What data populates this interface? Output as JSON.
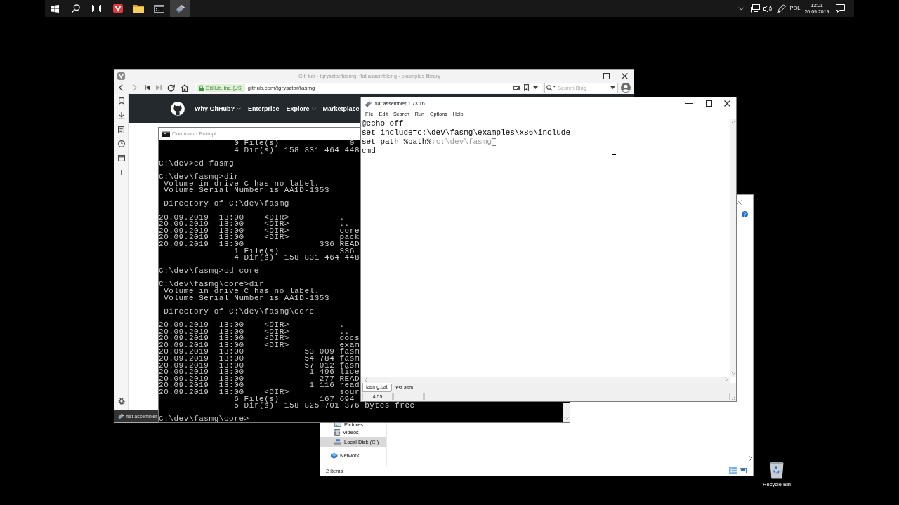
{
  "taskbar": {
    "buttons": [
      {
        "kind": "start",
        "active": false
      },
      {
        "kind": "search",
        "active": false
      },
      {
        "kind": "taskview",
        "active": false
      },
      {
        "kind": "browser",
        "active": false
      },
      {
        "kind": "files",
        "active": false
      },
      {
        "kind": "terminal",
        "active": false
      },
      {
        "kind": "assembler",
        "active": true
      }
    ],
    "tray": {
      "language": "POL",
      "time": "13:01",
      "date": "20.09.2019"
    }
  },
  "browser": {
    "active": false,
    "title": "GitHub - tgrysztar/fasmg: flat assembler g - examples library",
    "site_badge": "GitHub, Inc. [US]",
    "url": "github.com/tgrysztar/fasmg",
    "search": {
      "placeholder": "Search Bing"
    },
    "site_nav": [
      {
        "label": "Why GitHub?",
        "dropdown": true
      },
      {
        "label": "Enterprise",
        "dropdown": false
      },
      {
        "label": "Explore",
        "dropdown": true
      },
      {
        "label": "Marketplace",
        "dropdown": false
      }
    ],
    "bottom_tab": "flat assembler"
  },
  "console": {
    "active": false,
    "title": "Command Prompt",
    "blocks": [
      [
        "               0 File(s)              0",
        "               4 Dir(s)  158 831 464 448"
      ],
      [
        "C:\\dev>cd fasmg"
      ],
      [
        "C:\\dev\\fasmg>dir",
        " Volume in drive C has no label.",
        " Volume Serial Number is AA1D-1353"
      ],
      [
        " Directory of C:\\dev\\fasmg"
      ],
      [
        "20.09.2019  13:00    <DIR>          .",
        "20.09.2019  13:00    <DIR>          ..",
        "20.09.2019  13:00    <DIR>          core",
        "20.09.2019  13:00    <DIR>          pack",
        "20.09.2019  13:00               336 READ",
        "               1 File(s)            336",
        "               4 Dir(s)  158 831 464 448"
      ],
      [
        "C:\\dev\\fasmg>cd core"
      ],
      [
        "C:\\dev\\fasmg\\core>dir",
        " Volume in drive C has no label.",
        " Volume Serial Number is AA1D-1353"
      ],
      [
        " Directory of C:\\dev\\fasmg\\core"
      ],
      [
        "20.09.2019  13:00    <DIR>          .",
        "20.09.2019  13:00    <DIR>          ..",
        "20.09.2019  13:00    <DIR>          docs",
        "20.09.2019  13:00    <DIR>          exam",
        "20.09.2019  13:00            53 009 fasm",
        "20.09.2019  13:00            54 784 fasm",
        "20.09.2019  13:00            57 012 fasm",
        "20.09.2019  13:00             1 496 lice",
        "20.09.2019  13:00               277 READ",
        "20.09.2019  13:00             1 116 read",
        "20.09.2019  13:00    <DIR>          sour",
        "               6 File(s)        167 694",
        "               5 Dir(s)  158 825 701 376 bytes free"
      ],
      [
        "C:\\dev\\fasmg\\core>"
      ]
    ]
  },
  "editor": {
    "active": true,
    "title": "flat assembler 1.73.16",
    "menu": [
      "File",
      "Edit",
      "Search",
      "Run",
      "Options",
      "Help"
    ],
    "lines": [
      {
        "segments": [
          {
            "text": "@echo off",
            "faded": false
          }
        ]
      },
      {
        "segments": [
          {
            "text": "set include=c:\\dev\\fasmg\\examples\\x86\\include",
            "faded": false
          }
        ]
      },
      {
        "segments": [
          {
            "text": "set path=%path%",
            "faded": false
          },
          {
            "text": ";c:\\dev\\fasmg",
            "faded": true
          }
        ]
      },
      {
        "segments": [
          {
            "text": "cmd",
            "faded": false
          }
        ]
      }
    ],
    "tabs": [
      {
        "label": "fasmg.bat",
        "selected": true
      },
      {
        "label": "test.asm",
        "selected": false
      }
    ],
    "status": "4,55"
  },
  "explorer": {
    "navigation": [
      {
        "kind": "pictures",
        "label": "Pictures",
        "selected": false
      },
      {
        "kind": "videos",
        "label": "Videos",
        "selected": false
      },
      {
        "kind": "drive",
        "label": "Local Disk (C:)",
        "selected": true
      },
      {
        "kind": "network",
        "label": "Network",
        "selected": false
      }
    ],
    "status": "2 items",
    "views": [
      {
        "kind": "details",
        "selected": true
      },
      {
        "kind": "tiles",
        "selected": false
      }
    ]
  },
  "desktop_icons": [
    {
      "kind": "recycle",
      "label": "Recycle Bin"
    }
  ]
}
